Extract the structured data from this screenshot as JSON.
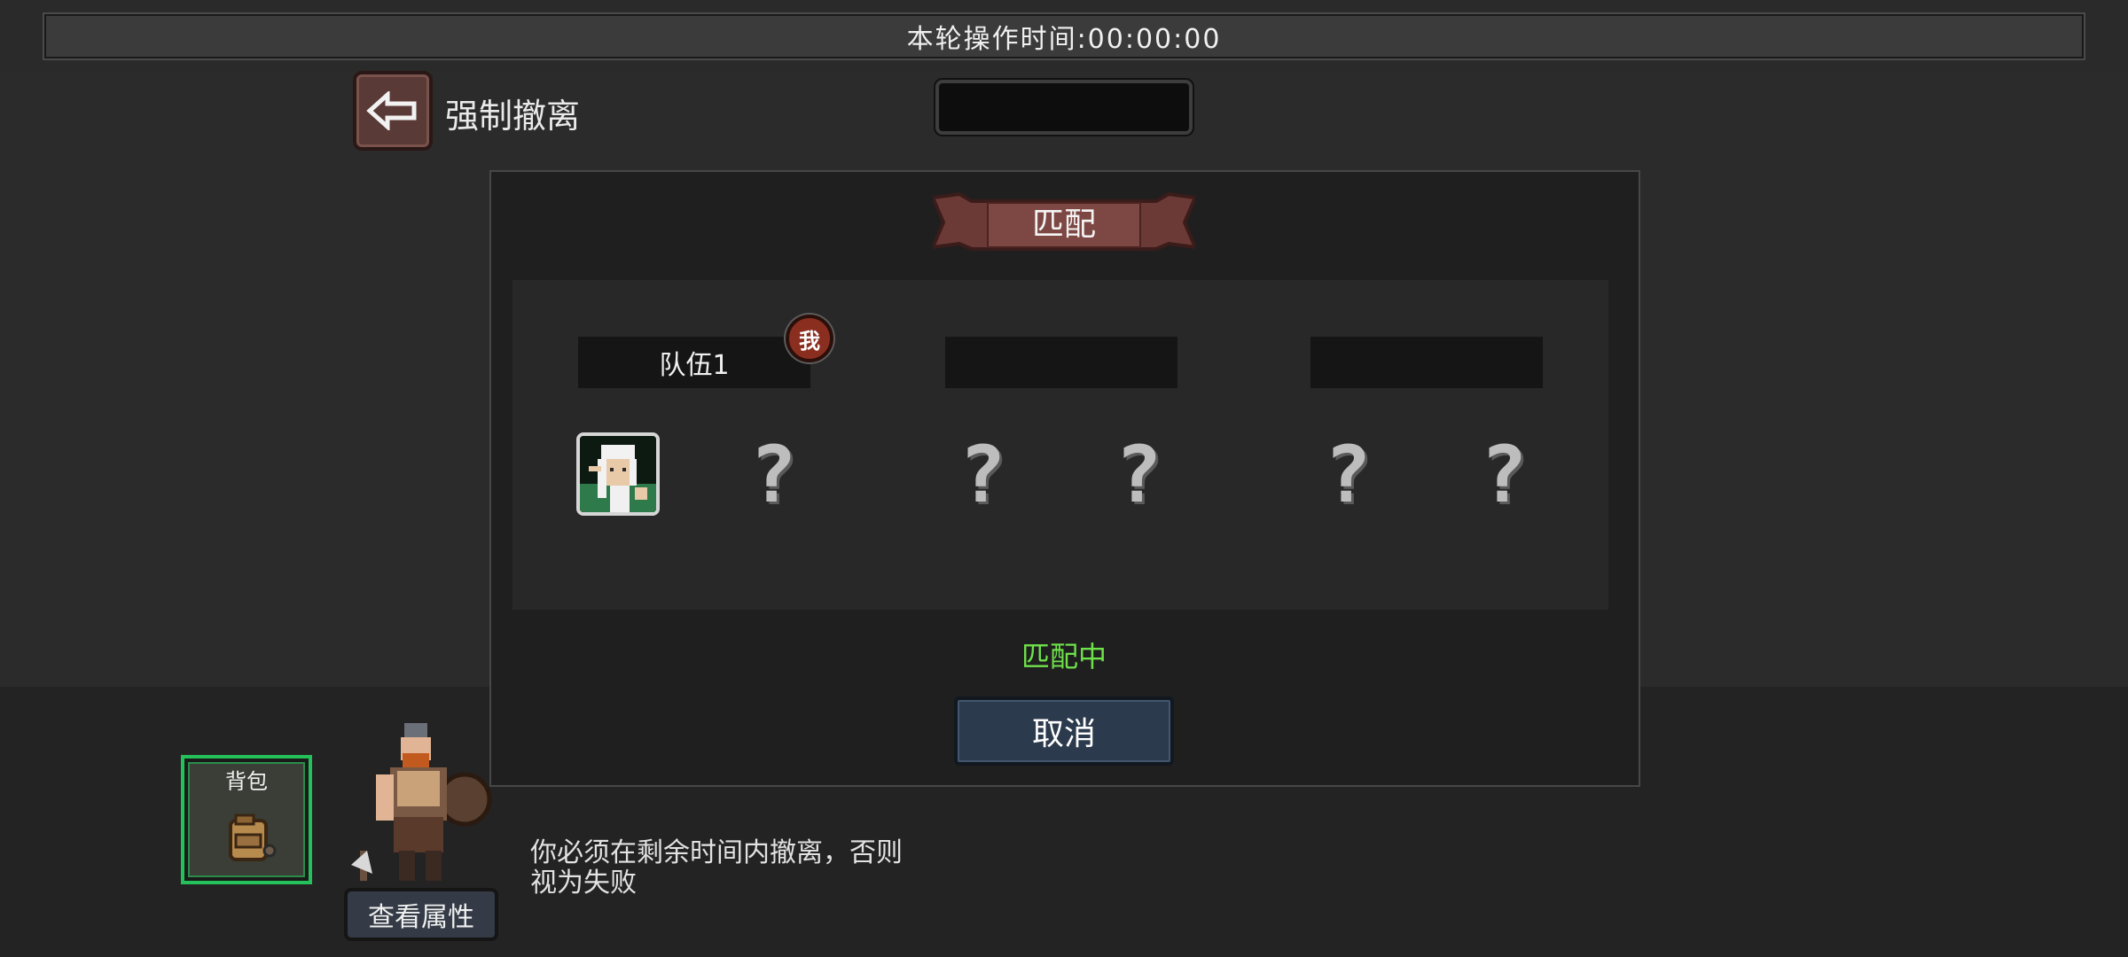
{
  "timer": {
    "label": "本轮操作时间:00:00:00"
  },
  "top_left": {
    "evacuate_label": "强制撤离"
  },
  "panel": {
    "title": "匹配",
    "status": "匹配中",
    "cancel_label": "取消",
    "me_badge": "我",
    "teams": [
      {
        "name": "队伍1"
      },
      {
        "name": ""
      },
      {
        "name": ""
      }
    ],
    "unknown_slot_glyph": "?"
  },
  "bottom": {
    "bag_label": "背包",
    "attributes_label": "查看属性",
    "hint": "你必须在剩余时间内撤离，否则视为失败"
  },
  "colors": {
    "status_green": "#6fe24a",
    "bag_border": "#24c05a",
    "cancel_bg": "#2c3a4d",
    "back_btn_bg": "#5a3a36"
  }
}
